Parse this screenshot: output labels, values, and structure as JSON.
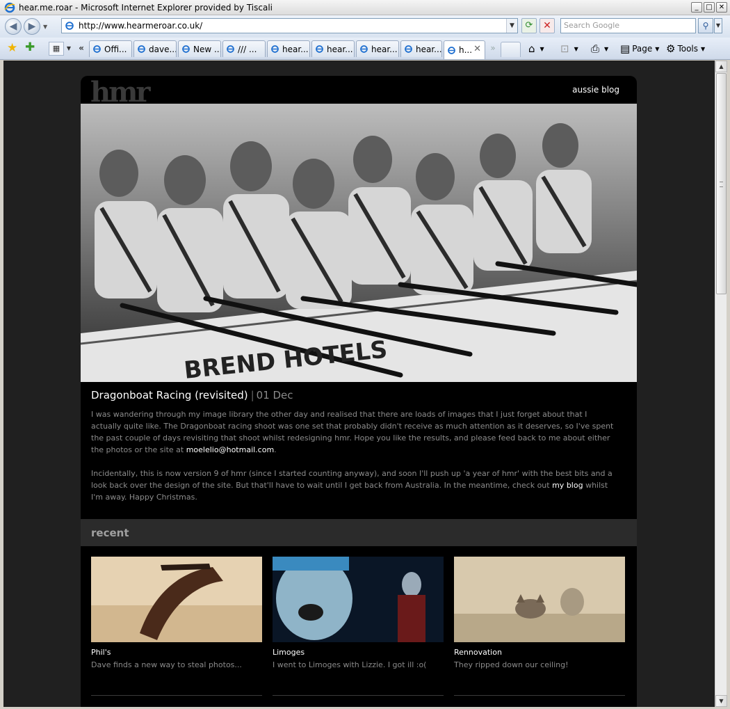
{
  "window": {
    "title": "hear.me.roar - Microsoft Internet Explorer provided by Tiscali",
    "minimize": "_",
    "maximize": "□",
    "close": "✕"
  },
  "address_bar": {
    "url": "http://www.hearmeroar.co.uk/",
    "search_placeholder": "Search Google"
  },
  "tabs": [
    {
      "label": "Offi..."
    },
    {
      "label": "dave..."
    },
    {
      "label": "New ..."
    },
    {
      "label": "/// ..."
    },
    {
      "label": "hear..."
    },
    {
      "label": "hear..."
    },
    {
      "label": "hear..."
    },
    {
      "label": "hear..."
    },
    {
      "label": "h..."
    }
  ],
  "command_bar": {
    "page": "Page",
    "tools": "Tools"
  },
  "site": {
    "logo": "hmr",
    "nav_link": "aussie blog"
  },
  "post": {
    "title": "Dragonboat Racing (revisited)",
    "separator": "|",
    "date": "01 Dec",
    "p1_text": "I was wandering through my image library the other day and realised that there are loads of images that I just forget about that I actually quite like. The Dragonboat racing shoot was one set that probably didn't receive as much attention as it deserves, so I've spent the past couple of days revisiting that shoot whilst redesigning hmr. Hope you like the results, and please feed back to me about either the photos or the site at ",
    "p1_email": "moelelio@hotmail.com",
    "p1_end": ".",
    "p2_text": "Incidentally, this is now version 9 of hmr (since I started counting anyway), and soon I'll push up 'a year of hmr' with the best bits and a look back over the design of the site. But that'll have to wait until I get back from Australia. In the meantime, check out ",
    "p2_link": "my blog",
    "p2_end": " whilst I'm away. Happy Christmas."
  },
  "recent": {
    "heading": "recent",
    "items": [
      {
        "title": "Phil's",
        "desc": "Dave finds a new way to steal photos..."
      },
      {
        "title": "Limoges",
        "desc": "I went to Limoges with Lizzie. I got ill :o("
      },
      {
        "title": "Rennovation",
        "desc": "They ripped down our ceiling!"
      }
    ]
  },
  "colors": {
    "page_bg": "#202020",
    "content_bg": "#000000",
    "recent_bar": "#2b2b2b",
    "body_text": "#8c8c8c",
    "link_text": "#ffffff"
  }
}
